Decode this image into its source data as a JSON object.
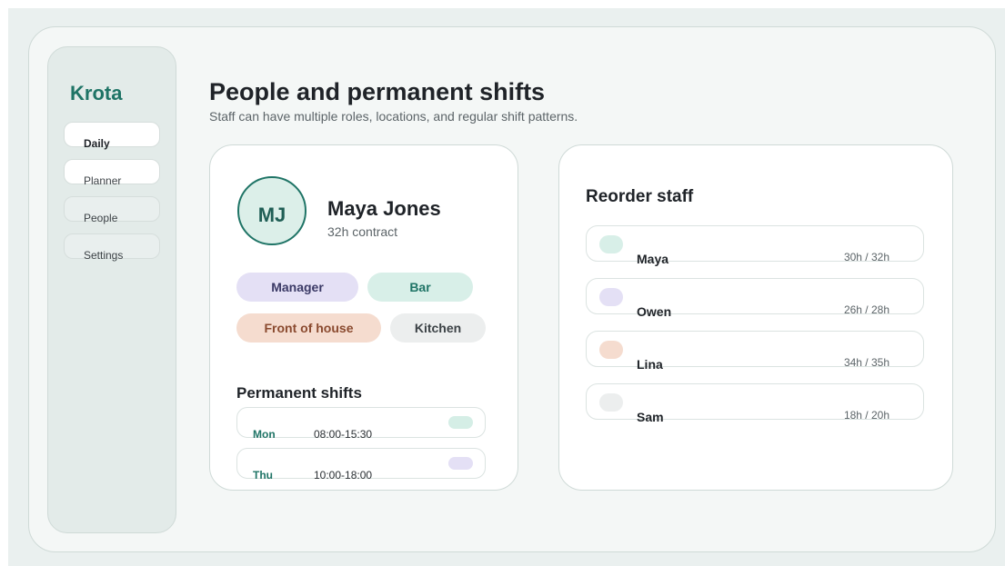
{
  "app": {
    "brand": "Krota"
  },
  "sidebar": {
    "items": [
      {
        "label": "Daily"
      },
      {
        "label": "Planner"
      },
      {
        "label": "People"
      },
      {
        "label": "Settings"
      }
    ]
  },
  "header": {
    "title": "People and permanent shifts",
    "subtitle": "Staff can have multiple roles, locations, and regular shift patterns."
  },
  "profile": {
    "initials": "MJ",
    "name": "Maya Jones",
    "contract": "32h contract",
    "roles": [
      "Manager",
      "Bar",
      "Front of house",
      "Kitchen"
    ],
    "permanent_shifts_title": "Permanent shifts",
    "shifts": [
      {
        "day": "Mon",
        "time": "08:00-15:30",
        "color": "#d5eee6"
      },
      {
        "day": "Thu",
        "time": "10:00-18:00",
        "color": "#e4e0f5"
      }
    ]
  },
  "reorder": {
    "title": "Reorder staff",
    "staff": [
      {
        "name": "Maya",
        "hours": "30h / 32h",
        "color": "#d8efe8"
      },
      {
        "name": "Owen",
        "hours": "26h / 28h",
        "color": "#e4e0f5"
      },
      {
        "name": "Lina",
        "hours": "34h / 35h",
        "color": "#f5dccf"
      },
      {
        "name": "Sam",
        "hours": "18h / 20h",
        "color": "#eceeee"
      }
    ]
  },
  "colors": {
    "accent": "#1f7466",
    "background": "#eaf0ef",
    "card": "#ffffff"
  }
}
